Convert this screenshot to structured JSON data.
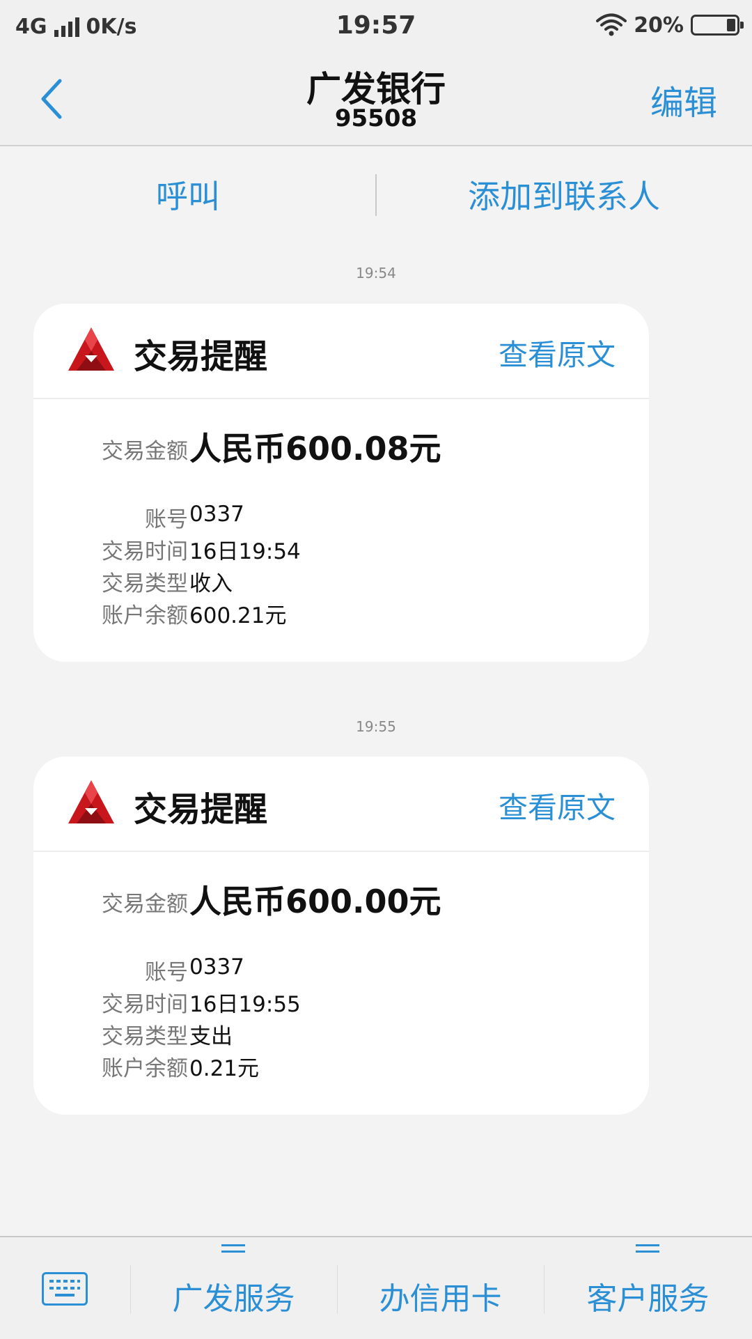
{
  "status_bar": {
    "network": "4G",
    "speed": "0K/s",
    "time": "19:57",
    "battery": "20%",
    "battery_level": 0.2
  },
  "header": {
    "title": "广发银行",
    "number": "95508",
    "edit_label": "编辑"
  },
  "actions": {
    "call_label": "呼叫",
    "add_contact_label": "添加到联系人"
  },
  "messages": [
    {
      "time": "19:54",
      "title": "交易提醒",
      "link_label": "查看原文",
      "amount_label": "交易金额",
      "amount": "人民币600.08元",
      "rows": [
        {
          "label": "账号",
          "value": "0337"
        },
        {
          "label": "交易时间",
          "value": "16日19:54"
        },
        {
          "label": "交易类型",
          "value": "收入"
        },
        {
          "label": "账户余额",
          "value": "600.21元"
        }
      ]
    },
    {
      "time": "19:55",
      "title": "交易提醒",
      "link_label": "查看原文",
      "amount_label": "交易金额",
      "amount": "人民币600.00元",
      "rows": [
        {
          "label": "账号",
          "value": "0337"
        },
        {
          "label": "交易时间",
          "value": "16日19:55"
        },
        {
          "label": "交易类型",
          "value": "支出"
        },
        {
          "label": "账户余额",
          "value": "0.21元"
        }
      ]
    }
  ],
  "bottom_nav": {
    "items": [
      {
        "label": "广发服务"
      },
      {
        "label": "办信用卡"
      },
      {
        "label": "客户服务"
      }
    ]
  },
  "colors": {
    "accent": "#2b8fd6",
    "logo_red": "#c8161d"
  },
  "icons": {
    "back": "chevron-left-icon",
    "logo": "cgb-logo-icon",
    "keyboard": "keyboard-icon",
    "menu": "menu-lines-icon"
  }
}
